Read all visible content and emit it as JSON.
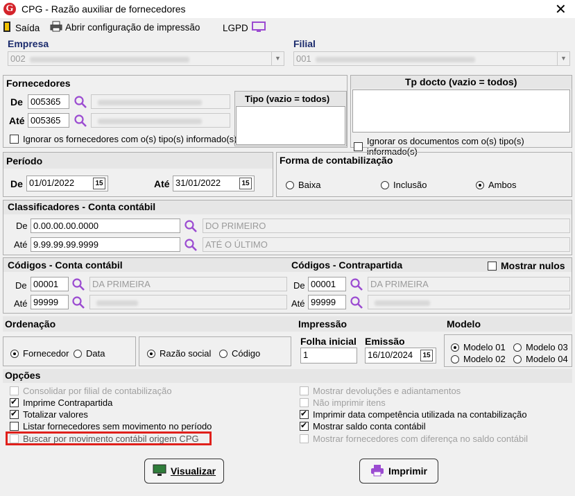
{
  "window": {
    "title": "CPG - Razão auxiliar de fornecedores",
    "close": "✕"
  },
  "toolbar": {
    "exit_label": "Saída",
    "print_config_label": "Abrir configuração de impressão",
    "lgpd_label": "LGPD"
  },
  "empresa": {
    "label": "Empresa",
    "code": "002"
  },
  "filial": {
    "label": "Filial",
    "code": "001"
  },
  "fornecedores": {
    "title": "Fornecedores",
    "de_label": "De",
    "ate_label": "Até",
    "de_value": "005365",
    "ate_value": "005365",
    "ignore_label": "Ignorar os fornecedores com o(s) tipo(s) informado(s)",
    "tipo_title": "Tipo (vazio = todos)"
  },
  "tpdocto": {
    "title": "Tp docto (vazio = todos)",
    "ignore_label": "Ignorar os documentos com o(s) tipo(s) informado(s)"
  },
  "periodo": {
    "title": "Período",
    "de_label": "De",
    "ate_label": "Até",
    "de_value": "01/01/2022",
    "ate_value": "31/01/2022",
    "cal_icon": "15"
  },
  "forma": {
    "title": "Forma de contabilização",
    "opt1": "Baixa",
    "opt2": "Inclusão",
    "opt3": "Ambos"
  },
  "classificadores": {
    "title": "Classificadores - Conta contábil",
    "de_label": "De",
    "ate_label": "Até",
    "de_value": "0.00.00.00.0000",
    "ate_value": "9.99.99.99.9999",
    "de_desc": "DO PRIMEIRO",
    "ate_desc": "ATÉ O ÚLTIMO"
  },
  "codigos_conta": {
    "title": "Códigos - Conta contábil",
    "de_label": "De",
    "ate_label": "Até",
    "de_value": "00001",
    "ate_value": "99999",
    "de_desc": "DA PRIMEIRA"
  },
  "codigos_contra": {
    "title": "Códigos - Contrapartida",
    "de_label": "De",
    "ate_label": "Até",
    "de_value": "00001",
    "ate_value": "99999",
    "de_desc": "DA PRIMEIRA",
    "mostrar_nulos": "Mostrar nulos"
  },
  "ordenacao": {
    "title": "Ordenação",
    "fornecedor": "Fornecedor",
    "data": "Data",
    "razao": "Razão social",
    "codigo": "Código"
  },
  "impressao": {
    "title": "Impressão",
    "folha_label": "Folha inicial",
    "folha_value": "1",
    "emissao_label": "Emissão",
    "emissao_value": "16/10/2024"
  },
  "modelo": {
    "title": "Modelo",
    "m1": "Modelo 01",
    "m2": "Modelo 02",
    "m3": "Modelo 03",
    "m4": "Modelo 04"
  },
  "opcoes": {
    "title": "Opções",
    "left": [
      "Consolidar por filial de contabilização",
      "Imprime Contrapartida",
      "Totalizar valores",
      "Listar fornecedores sem movimento no período",
      "Buscar por movimento contábil origem CPG"
    ],
    "right": [
      "Mostrar devoluções e adiantamentos",
      "Não imprimir itens",
      "Imprimir data competência utilizada na contabilização",
      "Mostrar saldo conta contábil",
      "Mostrar fornecedores com diferença no saldo contábil"
    ]
  },
  "buttons": {
    "visualizar": "Visualizar",
    "imprimir": "Imprimir"
  },
  "colors": {
    "accent_purple": "#9b4bd1",
    "highlight_red": "#e0201b",
    "header_blue": "#1a2a6c"
  }
}
